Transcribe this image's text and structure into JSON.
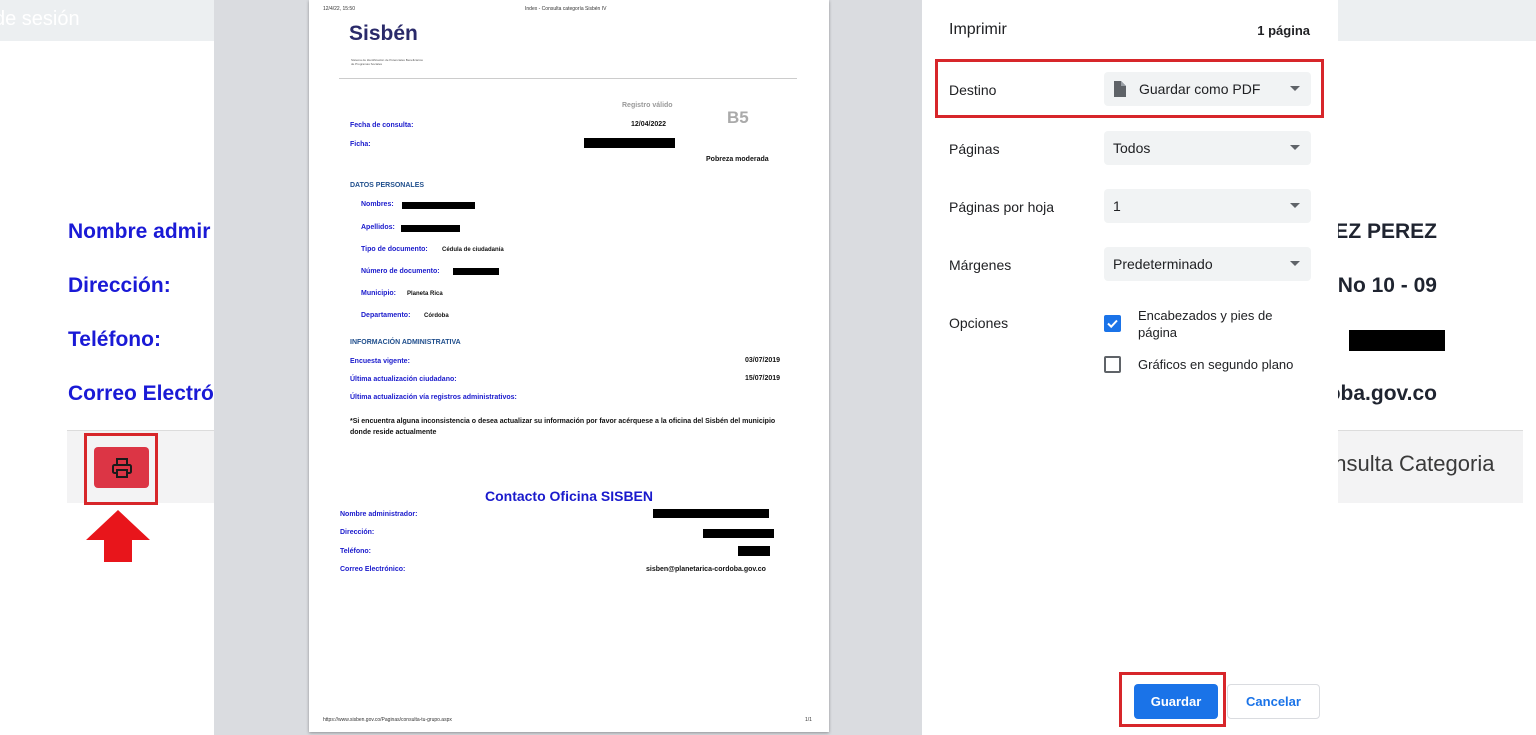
{
  "background_page": {
    "topbar_text": "de sesión",
    "labels": {
      "nombre": "Nombre admir",
      "direccion": "Dirección:",
      "telefono": "Teléfono:",
      "correo": "Correo Electrón"
    },
    "values": {
      "nombre": "DEZ PEREZ",
      "direccion": "No 10 - 09",
      "correo": "oba.gov.co"
    },
    "bar_text": "onsulta Categoria"
  },
  "preview": {
    "header_left": "12/4/22, 15:50",
    "header_center": "Index - Consulta categoría Sisbén IV",
    "logo_text": "Sisbén",
    "logo_sub": "Sistema de Identificación de Potenciales Beneficiarios de Programas Sociales",
    "registro_valido": "Registro válido",
    "grupo": "B5",
    "fecha_label": "Fecha de consulta:",
    "fecha_value": "12/04/2022",
    "ficha_label": "Ficha:",
    "pobreza": "Pobreza moderada",
    "datos_personales": "DATOS PERSONALES",
    "nombres_label": "Nombres:",
    "apellidos_label": "Apellidos:",
    "tipo_doc_label": "Tipo de documento:",
    "tipo_doc_value": "Cédula de ciudadanía",
    "num_doc_label": "Número de documento:",
    "municipio_label": "Municipio:",
    "municipio_value": "Planeta Rica",
    "departamento_label": "Departamento:",
    "departamento_value": "Córdoba",
    "info_admin": "INFORMACIÓN ADMINISTRATIVA",
    "encuesta_label": "Encuesta vigente:",
    "encuesta_value": "03/07/2019",
    "ultima_ciud_label": "Última actualización ciudadano:",
    "ultima_ciud_value": "15/07/2019",
    "ultima_reg_label": "Última actualización vía registros administrativos:",
    "nota": "*Si encuentra alguna inconsistencia o desea actualizar su información por favor acérquese a la oficina del Sisbén del municipio donde reside actualmente",
    "contacto_title": "Contacto Oficina SISBEN",
    "c_nombre": "Nombre administrador:",
    "c_direccion": "Dirección:",
    "c_telefono": "Teléfono:",
    "c_correo": "Correo Electrónico:",
    "c_correo_value": "sisben@planetarica-cordoba.gov.co",
    "footer_url": "https://www.sisben.gov.co/Paginas/consulta-tu-grupo.aspx",
    "footer_page": "1/1"
  },
  "dialog": {
    "title": "Imprimir",
    "page_count": "1 página",
    "rows": {
      "destino": {
        "label": "Destino",
        "value": "Guardar como PDF"
      },
      "paginas": {
        "label": "Páginas",
        "value": "Todos"
      },
      "por_hoja": {
        "label": "Páginas por hoja",
        "value": "1"
      },
      "margenes": {
        "label": "Márgenes",
        "value": "Predeterminado"
      }
    },
    "opciones_label": "Opciones",
    "opt_headers": {
      "label": "Encabezados y pies de página",
      "checked": true
    },
    "opt_graphics": {
      "label": "Gráficos en segundo plano",
      "checked": false
    },
    "save_label": "Guardar",
    "cancel_label": "Cancelar"
  },
  "colors": {
    "accent": "#1a73e8",
    "highlight": "#d7262a",
    "print_button": "#dc3545",
    "label_blue": "#1a1ad6"
  }
}
